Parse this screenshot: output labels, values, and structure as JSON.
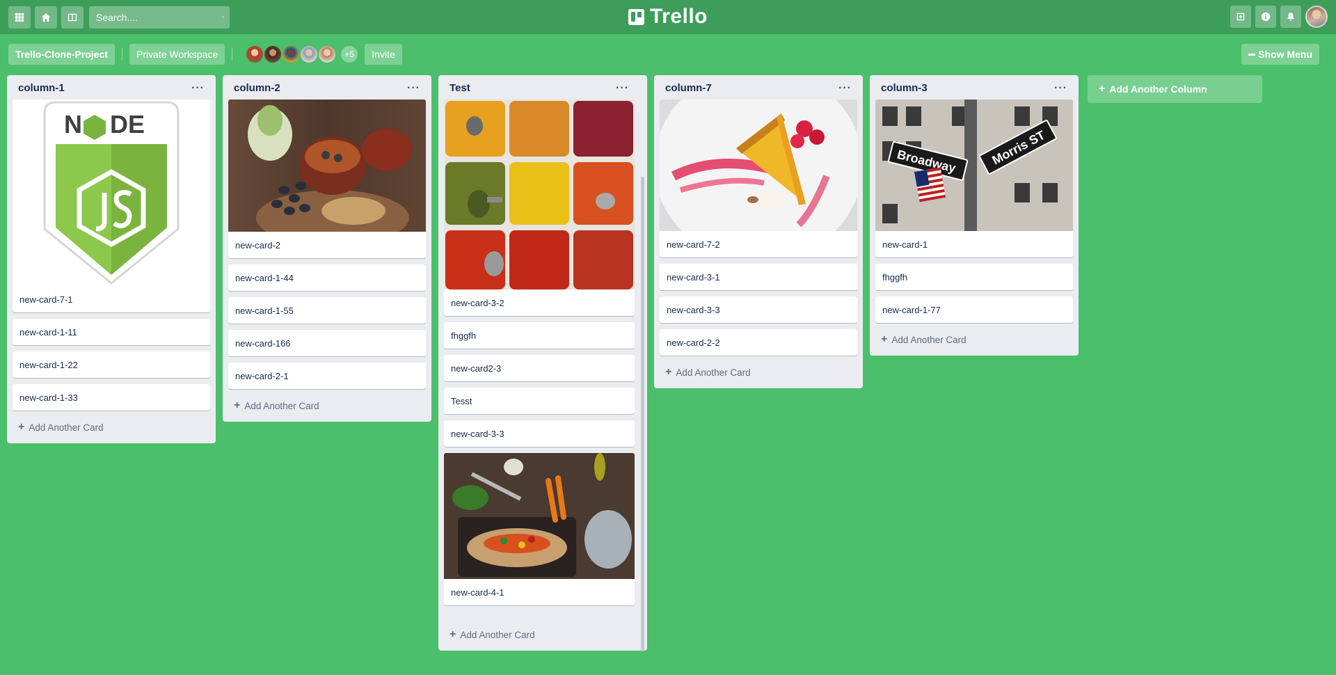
{
  "topbar": {
    "search_placeholder": "Search....",
    "logo_text": "Trello",
    "left_icons": [
      "apps-grid-icon",
      "home-icon",
      "boards-icon"
    ],
    "right_icons": [
      "plus-board-icon",
      "info-icon",
      "bell-icon"
    ]
  },
  "board": {
    "title": "Trello-Clone-Project",
    "workspace": "Private Workspace",
    "members_more": "+5",
    "invite": "Invite",
    "show_menu": "Show Menu",
    "add_column": "Add Another Column",
    "add_card": "Add Another Card",
    "menu_dots": "···"
  },
  "columns": [
    {
      "title": "column-1",
      "cards": [
        "new-card-7-1",
        "new-card-1-11",
        "new-card-1-22",
        "new-card-1-33"
      ]
    },
    {
      "title": "column-2",
      "cards": [
        "new-card-2",
        "new-card-1-44",
        "new-card-1-55",
        "new-card-166",
        "new-card-2-1"
      ]
    },
    {
      "title": "Test",
      "cards": [
        "new-card-3-2",
        "fhggfh",
        "new-card2-3",
        "Tesst",
        "new-card-3-3",
        "new-card-4-1"
      ]
    },
    {
      "title": "column-7",
      "cards": [
        "new-card-7-2",
        "new-card-3-1",
        "new-card-3-3",
        "new-card-2-2"
      ]
    },
    {
      "title": "column-3",
      "cards": [
        "new-card-1",
        "fhggfh",
        "new-card-1-77"
      ]
    }
  ],
  "colors": {
    "board_bg": "#4bbf6b",
    "topbar_bg": "#3d9e5a",
    "column_bg": "#ebecf0"
  }
}
